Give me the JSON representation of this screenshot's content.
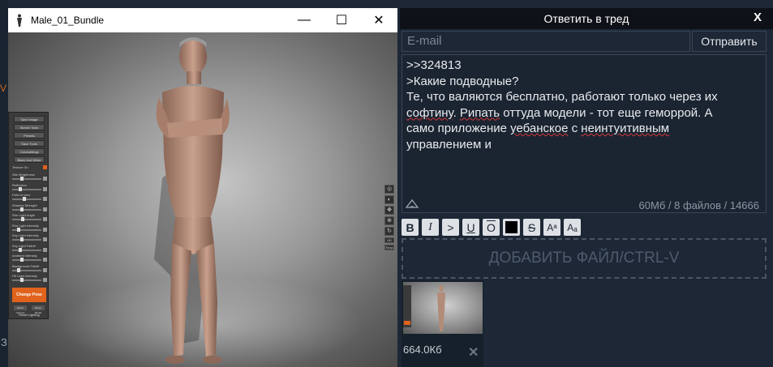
{
  "viewer": {
    "window_title": "Male_01_Bundle",
    "controls": {
      "minimize": "—",
      "maximize": "☐",
      "close": "✕"
    },
    "tool_panel": {
      "buttons": [
        "Save Image",
        "Sketch Tools",
        "Presets",
        "Save Tools",
        "Colorsettings",
        "Black And White"
      ],
      "toggle_label": "Texture On",
      "sliders": [
        "Skin Brightness",
        "Reflection",
        "Field of view",
        "Shadow Strength",
        "Rim Light Angle",
        "Rim Light Intensity",
        "Key Light Intensity",
        "Key Light Falloff",
        "Ambient Intensity",
        "Background Falloff",
        "Fill Light Intensity"
      ],
      "slider_levels": [
        0.3,
        0.25,
        0.4,
        0.3,
        0.35,
        0.2,
        0.3,
        0.25,
        0.3,
        0.2,
        0.3
      ],
      "change_pose": "Change Pose",
      "small_buttons": [
        "Reset Camera",
        "Reset Model"
      ],
      "reset_lighting": "Reset Lighting"
    },
    "side_icons": [
      "◎",
      "◐",
      "✥",
      "⊕",
      "↻",
      "HD",
      "Snap"
    ]
  },
  "reply": {
    "header": "Ответить в тред",
    "close": "X",
    "email_placeholder": "E-mail",
    "send_label": "Отправить",
    "message": {
      "line1": ">>324813",
      "line2": ">Какие подводные?",
      "line3": "Те, что валяются бесплатно, работают только через их",
      "line4_a": "софтину",
      "line4_b": ". ",
      "line4_c": "Рипать",
      "line4_d": " оттуда модели - тот еще геморрой. А",
      "line5_a": "само приложение ",
      "line5_b": "уебанское",
      "line5_c": " с ",
      "line5_d": "неинтуитивным",
      "line6": "управлением и"
    },
    "stats": "60Мб / 8 файлов / 14666",
    "format_buttons": [
      "B",
      "I",
      ">",
      "U",
      "O",
      "",
      "S",
      "Aᵃ",
      "Aₐ"
    ],
    "dropzone_label": "ДОБАВИТЬ ФАЙЛ/CTRL-V",
    "attachment": {
      "size": "664.0Кб",
      "remove": "✕"
    }
  },
  "background": {
    "edge_letter": "V",
    "edge_letter2": "З"
  },
  "colors": {
    "accent_orange": "#e0621c",
    "panel_bg": "#1d2735",
    "header_bg": "#0e1218",
    "spellcheck": "#d73838"
  }
}
